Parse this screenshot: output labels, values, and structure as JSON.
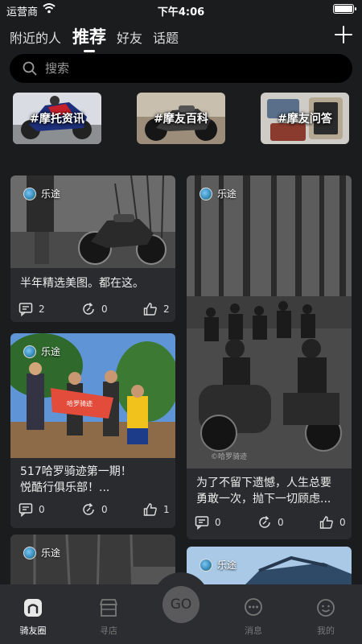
{
  "status_bar": {
    "carrier": "运营商",
    "time": "下午4:06"
  },
  "nav": {
    "tabs": [
      {
        "label": "附近的人"
      },
      {
        "label": "推荐",
        "active": true
      },
      {
        "label": "好友"
      },
      {
        "label": "话题"
      }
    ],
    "add_icon": "plus-icon"
  },
  "search": {
    "placeholder": "搜索",
    "icon": "search-icon"
  },
  "topics": [
    {
      "label": "#摩托资讯"
    },
    {
      "label": "#摩友百科"
    },
    {
      "label": "#摩友问答"
    }
  ],
  "feed": {
    "cards": [
      {
        "author": "乐途",
        "caption": "半年精选美图。都在这。",
        "comments": "2",
        "reposts": "0",
        "likes": "2"
      },
      {
        "author": "乐途",
        "caption_line1": "517哈罗骑迹第一期！",
        "caption_line2": "悦酷行俱乐部！...",
        "comments": "0",
        "reposts": "0",
        "likes": "1",
        "banner_text": "哈罗骑迹"
      },
      {
        "author": "乐途"
      },
      {
        "author": "乐途",
        "caption_line1": "为了不留下遗憾，人生总要",
        "caption_line2": "勇敢一次，抛下一切顾虑...",
        "comments": "0",
        "reposts": "0",
        "likes": "0",
        "watermark": "©哈罗骑迹"
      },
      {
        "author": "乐途"
      }
    ]
  },
  "bottom_nav": {
    "items": [
      {
        "label": "骑友圈",
        "icon": "home-icon",
        "active": true
      },
      {
        "label": "寻店",
        "icon": "store-icon"
      },
      {
        "label": "消息",
        "icon": "message-icon"
      },
      {
        "label": "我的",
        "icon": "profile-icon"
      }
    ],
    "go_label": "GO"
  },
  "colors": {
    "background": "#1b1c1e",
    "card": "#2a2b2e",
    "bottom_bar": "#2c2d30",
    "go_button": "#5a5a5c"
  }
}
